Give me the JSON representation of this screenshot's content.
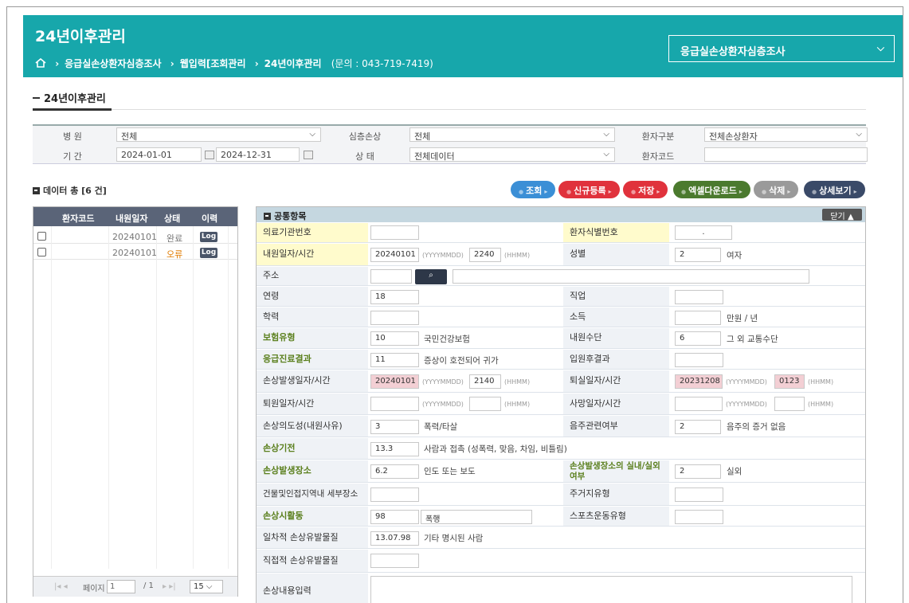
{
  "header": {
    "title": "24년이후관리",
    "breadcrumb": [
      "응급실손상환자심층조사",
      "웹입력[조회관리",
      "24년이후관리"
    ],
    "contact": "(문의 : 043-719-7419)",
    "system_select": "응급실손상환자심층조사"
  },
  "section_title": "24년이후관리",
  "filter": {
    "hospital_label": "병  원",
    "hospital_value": "전체",
    "deep_label": "심층손상",
    "deep_value": "전체",
    "ptype_label": "환자구분",
    "ptype_value": "전체손상환자",
    "period_label": "기  간",
    "date_from": "2024-01-01",
    "date_to": "2024-12-31",
    "status_label": "상  태",
    "status_value": "전체데이터",
    "pcode_label": "환자코드",
    "pcode_value": ""
  },
  "data_count": "데이터 총 [6 건]",
  "buttons": {
    "search": "조회",
    "new": "신규등록",
    "save": "저장",
    "excel": "엑셀다운로드",
    "delete": "삭제",
    "detail": "상세보기"
  },
  "list": {
    "columns": [
      "환자코드",
      "내원일자",
      "상태",
      "이력"
    ],
    "rows": [
      {
        "code": "",
        "date": "20240101",
        "status": "완료",
        "log": "Log"
      },
      {
        "code": "",
        "date": "20240101",
        "status": "오류",
        "log": "Log"
      }
    ],
    "pager": {
      "page_label": "페이지",
      "page": "1",
      "total": "/ 1",
      "size": "15"
    }
  },
  "form": {
    "section": "공통항목",
    "close": "닫기 ▲",
    "org_no": {
      "label": "의료기관번호",
      "value": ""
    },
    "pid": {
      "label": "환자식별번호",
      "value": "."
    },
    "visit": {
      "label": "내원일자/시간",
      "date": "20240101",
      "date_hint": "(YYYYMMDD)",
      "time": "2240",
      "time_hint": "(HHMM)"
    },
    "sex": {
      "label": "성별",
      "code": "2",
      "text": "여자"
    },
    "address": {
      "label": "주소"
    },
    "age": {
      "label": "연령",
      "value": "18"
    },
    "job": {
      "label": "직업",
      "value": ""
    },
    "edu": {
      "label": "학력",
      "value": ""
    },
    "income": {
      "label": "소득",
      "value": "",
      "unit": "만원 / 년"
    },
    "insurance": {
      "label": "보험유형",
      "code": "10",
      "text": "국민건강보험"
    },
    "arrival": {
      "label": "내원수단",
      "code": "6",
      "text": "그 외 교통수단"
    },
    "er_result": {
      "label": "응급진료결과",
      "code": "11",
      "text": "증상이 호전되어 귀가"
    },
    "adm_result": {
      "label": "입원후결과",
      "value": ""
    },
    "injury_time": {
      "label": "손상발생일자/시간",
      "date": "20240101",
      "date_hint": "(YYYYMMDD)",
      "time": "2140",
      "time_hint": "(HHMM)"
    },
    "discharge_time": {
      "label": "퇴실일자/시간",
      "date": "20231208",
      "date_hint": "(YYYYMMDD)",
      "time": "0123",
      "time_hint": "(HHMM)"
    },
    "leave_time": {
      "label": "퇴원일자/시간",
      "date_hint": "(YYYYMMDD)",
      "time_hint": "(HHMM)"
    },
    "death_time": {
      "label": "사망일자/시간",
      "date_hint": "(YYYYMMDD)",
      "time_hint": "(HHMM)"
    },
    "intent": {
      "label": "손상의도성(내원사유)",
      "code": "3",
      "text": "폭력/타살"
    },
    "alcohol": {
      "label": "음주관련여부",
      "code": "2",
      "text": "음주의 증거 없음"
    },
    "mechanism": {
      "label": "손상기전",
      "code": "13.3",
      "text": "사람과 접촉 (성폭력, 맞음, 차임, 비틀림)"
    },
    "place": {
      "label": "손상발생장소",
      "code": "6.2",
      "text": "인도 또는 보도"
    },
    "inout": {
      "label": "손상발생장소의 실내/실외 여부",
      "code": "2",
      "text": "실외"
    },
    "building": {
      "label": "건물및인접지역내 세부장소",
      "value": ""
    },
    "residence": {
      "label": "주거지유형",
      "value": ""
    },
    "activity": {
      "label": "손상시활동",
      "code": "98",
      "text": "폭행"
    },
    "sport": {
      "label": "스포츠운동유형",
      "value": ""
    },
    "primary_obj": {
      "label": "일차적 손상유발물질",
      "code": "13.07.98",
      "text": "기타 명시된 사람"
    },
    "direct_obj": {
      "label": "직접적 손상유발물질",
      "value": ""
    },
    "narrative": {
      "label": "손상내용입력",
      "value": ""
    }
  },
  "colors": {
    "header": "#17a7ab",
    "btn_blue": "#3b8fd6",
    "btn_red": "#e0323c",
    "btn_green": "#4b7a2e",
    "btn_gray": "#9a9a9a",
    "btn_navy": "#3a4a68",
    "error": "#e07b00"
  }
}
